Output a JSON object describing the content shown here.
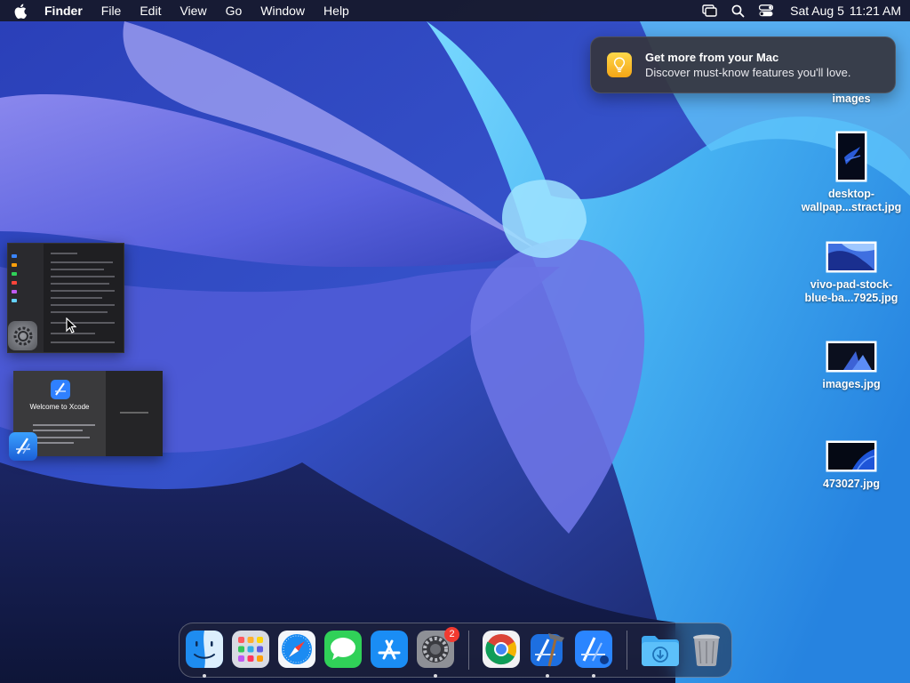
{
  "menubar": {
    "app_name": "Finder",
    "items": [
      "File",
      "Edit",
      "View",
      "Go",
      "Window",
      "Help"
    ],
    "date": "Sat Aug 5",
    "time": "11:21 AM",
    "status_icons": [
      "screen-mirroring-icon",
      "spotlight-search-icon",
      "control-center-icon"
    ]
  },
  "notification": {
    "title": "Get more from your Mac",
    "body": "Discover must-know features you'll love.",
    "icon": "lightbulb-icon"
  },
  "desktop": {
    "items": [
      {
        "label": "images",
        "kind": "folder"
      },
      {
        "label": "desktop-\nwallpap...stract.jpg",
        "kind": "image"
      },
      {
        "label": "vivo-pad-stock-\nblue-ba...7925.jpg",
        "kind": "image"
      },
      {
        "label": "images.jpg",
        "kind": "image"
      },
      {
        "label": "473027.jpg",
        "kind": "image"
      }
    ]
  },
  "windows": {
    "xcode_welcome": "Welcome to Xcode"
  },
  "dock": {
    "apps": [
      {
        "name": "Finder",
        "running": true
      },
      {
        "name": "Launchpad",
        "running": false
      },
      {
        "name": "Safari",
        "running": false
      },
      {
        "name": "Messages",
        "running": false
      },
      {
        "name": "App Store",
        "running": false
      },
      {
        "name": "System Settings",
        "running": true,
        "badge": "2"
      },
      {
        "name": "Google Chrome",
        "running": false
      },
      {
        "name": "Xcode",
        "running": true
      },
      {
        "name": "Instruments",
        "running": true
      },
      {
        "name": "Downloads",
        "running": false
      },
      {
        "name": "Trash",
        "running": false
      }
    ]
  },
  "colors": {
    "menubar_bg": "#161828",
    "badge": "#f23a30",
    "notification_bg": "#36363e",
    "bulb": "#f4a516"
  }
}
